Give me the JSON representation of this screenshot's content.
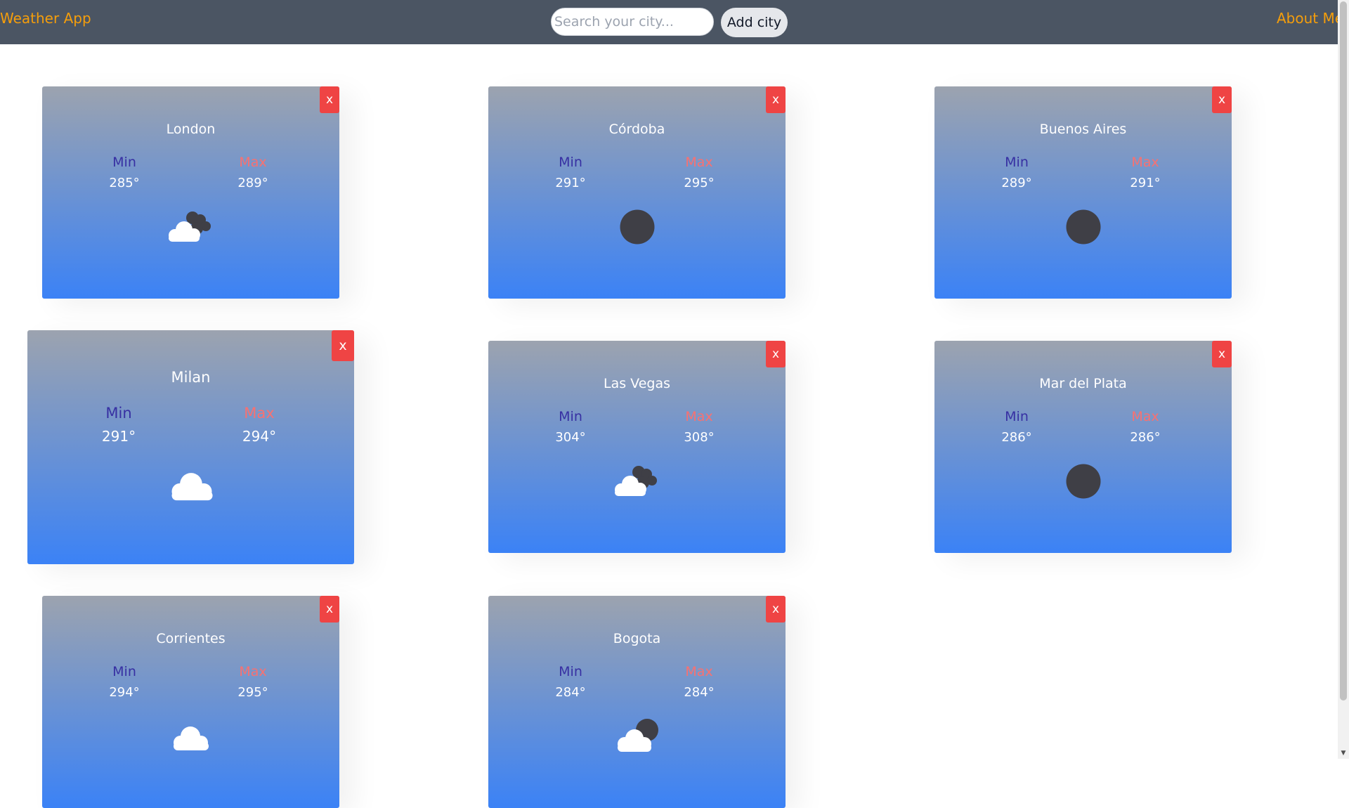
{
  "header": {
    "brand": "Weather App",
    "search_placeholder": "Search your city...",
    "add_button": "Add city",
    "about": "About Me"
  },
  "colors": {
    "nav": "#4b5563",
    "accent": "#f59e0b",
    "card_top": "#9ca3af",
    "card_bottom": "#3b82f6",
    "close": "#ef4444",
    "min_label": "#3730a3",
    "max_label": "#f87171"
  },
  "card_labels": {
    "min": "Min",
    "max": "Max",
    "close": "x"
  },
  "cards": [
    {
      "city": "London",
      "min": "285°",
      "max": "289°",
      "icon": "partly-cloudy-night-icon"
    },
    {
      "city": "Córdoba",
      "min": "291°",
      "max": "295°",
      "icon": "clear-night-icon"
    },
    {
      "city": "Buenos Aires",
      "min": "289°",
      "max": "291°",
      "icon": "clear-night-icon"
    },
    {
      "city": "Milan",
      "min": "291°",
      "max": "294°",
      "icon": "cloud-icon"
    },
    {
      "city": "Las Vegas",
      "min": "304°",
      "max": "308°",
      "icon": "partly-cloudy-night-icon"
    },
    {
      "city": "Mar del Plata",
      "min": "286°",
      "max": "286°",
      "icon": "clear-night-icon"
    },
    {
      "city": "Corrientes",
      "min": "294°",
      "max": "295°",
      "icon": "cloud-icon"
    },
    {
      "city": "Bogota",
      "min": "284°",
      "max": "284°",
      "icon": "cloud-moon-icon"
    }
  ]
}
